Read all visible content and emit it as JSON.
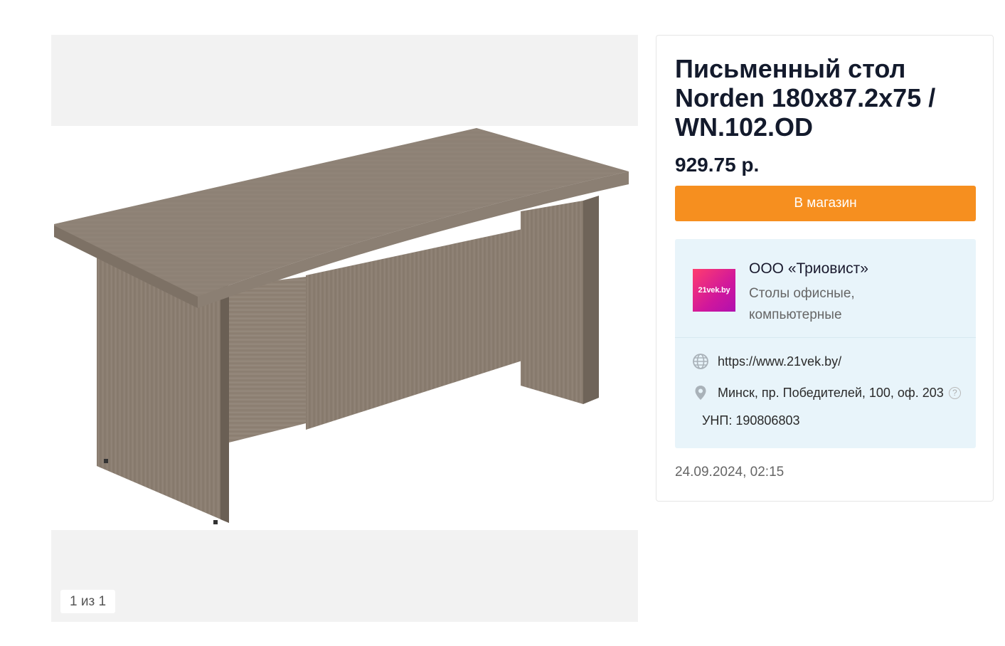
{
  "gallery": {
    "counter": "1 из 1",
    "image_alt": "Письменный стол Norden"
  },
  "product": {
    "title": "Письменный стол Norden 180x87.2x75 / WN.102.OD",
    "price": "929.75 р.",
    "button_label": "В магазин",
    "button_color": "#f68f1f"
  },
  "seller": {
    "logo_text": "21vek.by",
    "name": "ООО «Триовист»",
    "category": "Столы офисные, компьютерные",
    "url": "https://www.21vek.by/",
    "address": "Минск, пр. Победителей, 100, оф. 203",
    "unp": "УНП: 190806803",
    "background": "#e8f4fa"
  },
  "timestamp": "24.09.2024, 02:15"
}
